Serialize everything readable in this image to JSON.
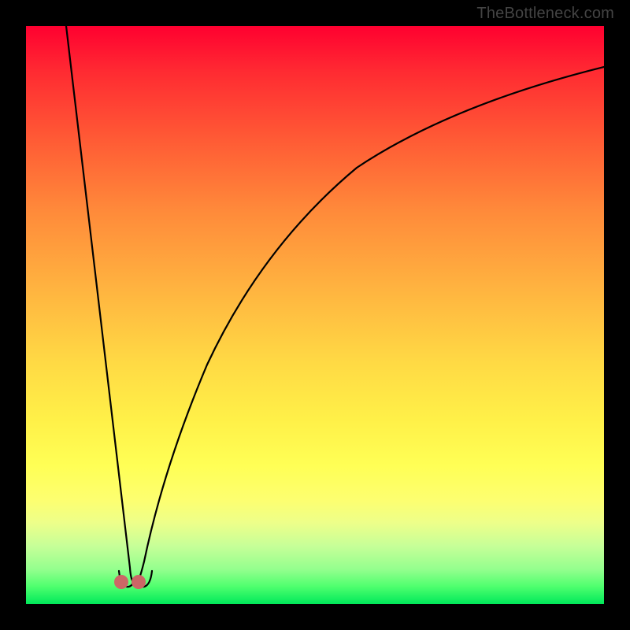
{
  "watermark": "TheBottleneck.com",
  "colors": {
    "frame": "#000000",
    "curve": "#000000",
    "dot": "#cc6666",
    "gradient_top": "#ff0030",
    "gradient_bottom": "#00e85a"
  },
  "chart_data": {
    "type": "line",
    "title": "",
    "xlabel": "",
    "ylabel": "",
    "xlim": [
      0,
      100
    ],
    "ylim": [
      0,
      100
    ],
    "notch_x": 18,
    "series": [
      {
        "name": "left-branch",
        "x": [
          7,
          8,
          9,
          10,
          11,
          12,
          13,
          14,
          15,
          16,
          17,
          18
        ],
        "values": [
          100,
          91,
          82,
          73,
          64,
          55,
          45,
          36,
          27,
          18,
          9,
          0
        ]
      },
      {
        "name": "right-branch",
        "x": [
          18,
          20,
          22,
          24,
          27,
          30,
          34,
          38,
          44,
          50,
          58,
          66,
          76,
          86,
          100
        ],
        "values": [
          0,
          12,
          22,
          31,
          41,
          49,
          57,
          63,
          70,
          75,
          80,
          84,
          88,
          91,
          94
        ]
      }
    ],
    "markers": [
      {
        "name": "notch-marker-left",
        "x": 16.5,
        "y": 3
      },
      {
        "name": "notch-marker-right",
        "x": 19.5,
        "y": 3
      }
    ],
    "annotations": []
  }
}
